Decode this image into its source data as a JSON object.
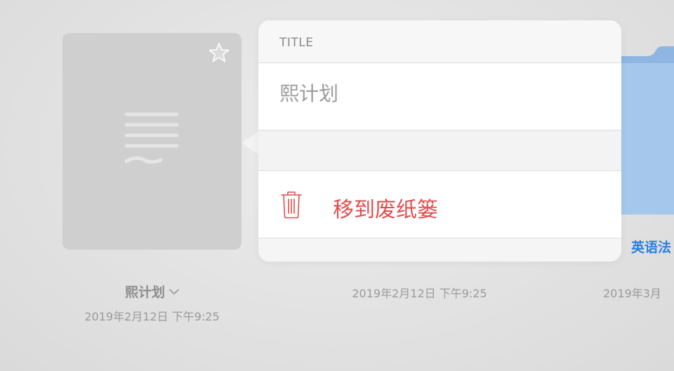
{
  "document": {
    "name": "熙计划",
    "date": "2019年2月12日 下午9:25"
  },
  "middle_item": {
    "date": "2019年2月12日 下午9:25"
  },
  "folder": {
    "label": "英语法",
    "date": "2019年3月"
  },
  "popover": {
    "header_label": "TITLE",
    "title_value": "熙计划",
    "trash_label": "移到废纸篓"
  },
  "colors": {
    "destructive": "#e24c4c",
    "folder_blue": "#a8c8ec",
    "folder_label": "#2c7fdc"
  },
  "icons": {
    "star": "star-icon",
    "document": "document-lines-icon",
    "chevron": "chevron-down-icon",
    "trash": "trash-icon",
    "folder": "folder-icon"
  }
}
